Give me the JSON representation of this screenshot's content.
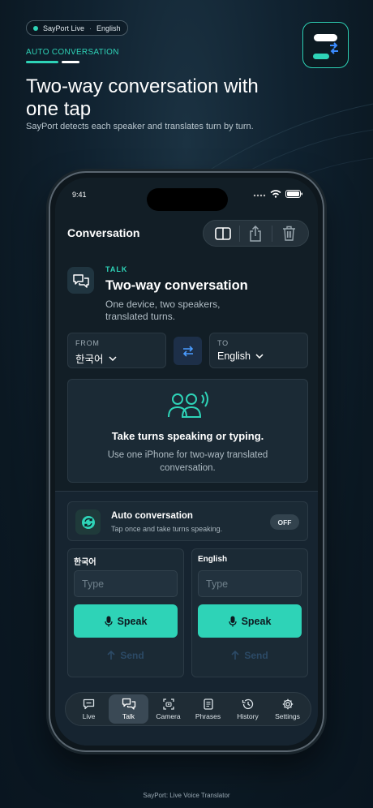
{
  "hero": {
    "pill_app": "SayPort Live",
    "pill_sep": "·",
    "pill_lang": "English",
    "eyebrow": "AUTO CONVERSATION",
    "title": "Two-way conversation with one tap",
    "subtitle": "SayPort detects each speaker and translates turn by turn."
  },
  "status_bar": {
    "time": "9:41"
  },
  "nav": {
    "title": "Conversation",
    "toolbar_icons": [
      "split-view-icon",
      "share-icon",
      "trash-icon"
    ]
  },
  "talk": {
    "eyebrow": "TALK",
    "title": "Two-way conversation",
    "subtitle": "One device, two speakers, translated turns."
  },
  "languages": {
    "from_label": "FROM",
    "from_value": "한국어",
    "to_label": "TO",
    "to_value": "English"
  },
  "empty_state": {
    "title": "Take turns speaking or typing.",
    "body": "Use one iPhone for two-way translated conversation."
  },
  "auto": {
    "title": "Auto conversation",
    "subtitle": "Tap once and take turns speaking.",
    "toggle": "OFF"
  },
  "sides": [
    {
      "label": "한국어",
      "placeholder": "Type",
      "speak": "Speak",
      "send": "Send"
    },
    {
      "label": "English",
      "placeholder": "Type",
      "speak": "Speak",
      "send": "Send"
    }
  ],
  "tabs": [
    {
      "label": "Live",
      "icon": "chat-bubble-icon"
    },
    {
      "label": "Talk",
      "icon": "two-bubbles-icon",
      "active": true
    },
    {
      "label": "Camera",
      "icon": "camera-scan-icon"
    },
    {
      "label": "Phrases",
      "icon": "phrasebook-icon"
    },
    {
      "label": "History",
      "icon": "history-icon"
    },
    {
      "label": "Settings",
      "icon": "gear-icon"
    }
  ],
  "footer": "SayPort: Live Voice Translator",
  "colors": {
    "accent": "#2ed3b7",
    "background": "#0b1822",
    "card": "#1b2a35",
    "send_disabled": "#2c4a66"
  }
}
